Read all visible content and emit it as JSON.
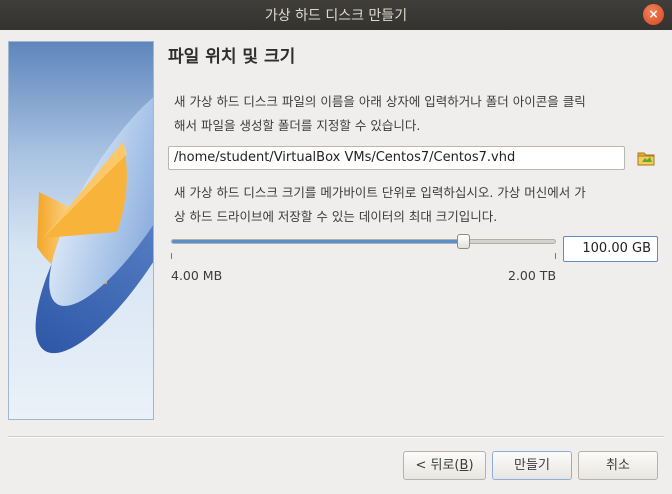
{
  "window": {
    "title": "가상 하드 디스크 만들기",
    "close_glyph": "×"
  },
  "page": {
    "title": "파일 위치 및 크기"
  },
  "location": {
    "description_line1": "새 가상 하드 디스크 파일의 이름을 아래 상자에 입력하거나 폴더 아이콘을 클릭",
    "description_line2": "해서 파일을 생성할 폴더를 지정할 수 있습니다.",
    "path_value": "/home/student/VirtualBox VMs/Centos7/Centos7.vhd"
  },
  "size": {
    "description_line1": "새 가상 하드 디스크 크기를 메가바이트 단위로 입력하십시오. 가상 머신에서 가",
    "description_line2": "상 하드 드라이브에 저장할 수 있는 데이터의 최대 크기입니다.",
    "value": "100.00 GB",
    "slider_fraction": 0.755,
    "min_label": "4.00 MB",
    "max_label": "2.00 TB"
  },
  "buttons": {
    "back_prefix": "< 뒤로(",
    "back_mnemonic": "B",
    "back_suffix": ")",
    "create": "만들기",
    "cancel": "취소"
  },
  "colors": {
    "accent": "#5a8fcf",
    "titlebar": "#3a3935",
    "close": "#e05a2b"
  }
}
